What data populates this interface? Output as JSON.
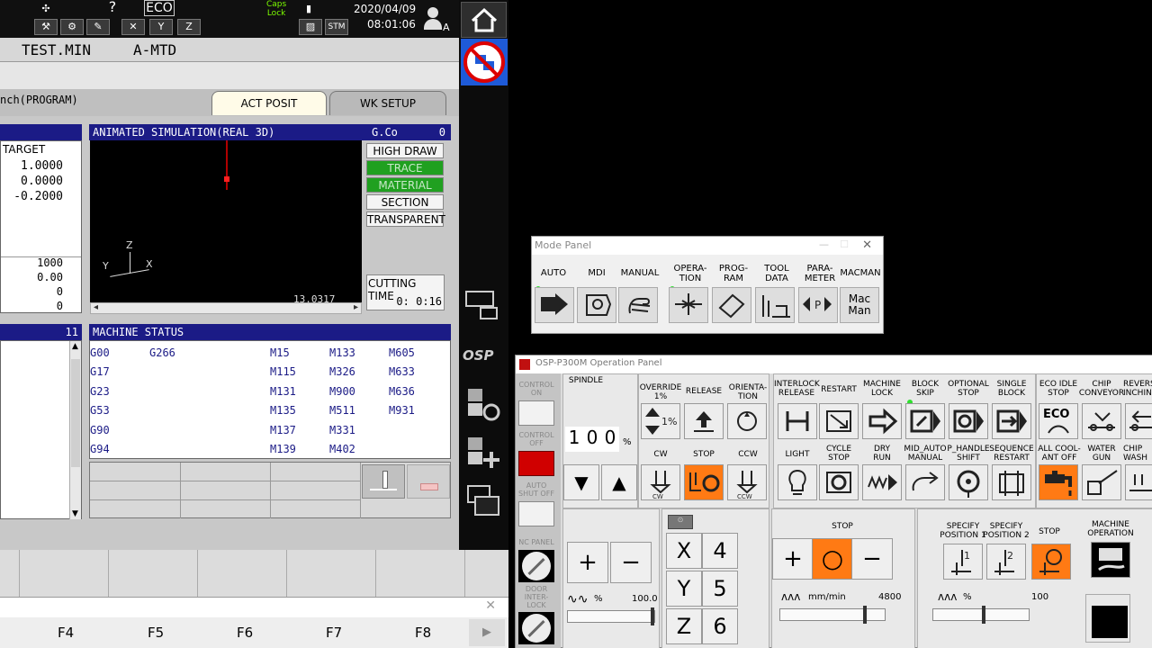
{
  "topbar": {
    "caps_lock": "Caps\nLock",
    "eco": "ECO",
    "stm": "STM",
    "date": "2020/04/09",
    "time": "08:01:06",
    "user_suffix": "A",
    "help": "?"
  },
  "filebar": {
    "program": "TEST.MIN",
    "subprogram": "A-MTD"
  },
  "tabs": {
    "launch": "nch(PROGRAM)",
    "act_posit": "ACT POSIT",
    "wk_setup": "WK SETUP"
  },
  "target": {
    "label": "TARGET",
    "values": [
      "1.0000",
      "0.0000",
      "-0.2000"
    ],
    "lower_values": [
      "1000",
      "0.00",
      "0",
      "0"
    ]
  },
  "simulation": {
    "title": "ANIMATED SIMULATION(REAL 3D)",
    "gcode_label": "G.Co",
    "gcode_value": "0",
    "buttons": [
      "HIGH DRAW",
      "TRACE",
      "MATERIAL",
      "SECTION",
      "TRANSPARENT"
    ],
    "axis_z": "Z",
    "axis_y": "Y",
    "axis_x": "X",
    "coord_readout": "13.0317",
    "cutting_time_label": "CUTTING TIME",
    "cutting_time_value": "0: 0:16"
  },
  "machine_status": {
    "title": "MACHINE STATUS",
    "count": "11",
    "g_codes_col1": [
      "G00",
      "G17",
      "G23",
      "G53",
      "G90",
      "G94"
    ],
    "g_codes_col2": [
      "G266"
    ],
    "m_codes_col1": [
      "M15",
      "M115",
      "M131",
      "M135",
      "M137",
      "M139"
    ],
    "m_codes_col2": [
      "M133",
      "M326",
      "M900",
      "M511",
      "M331",
      "M402"
    ],
    "m_codes_col3": [
      "M605",
      "M633",
      "M636",
      "M931"
    ]
  },
  "fkeys": [
    "F4",
    "F5",
    "F6",
    "F7",
    "F8"
  ],
  "sidebar": {
    "osp_logo": "OSP"
  },
  "mode_panel": {
    "title": "Mode Panel",
    "modes": [
      "AUTO",
      "MDI",
      "MANUAL",
      "OPERA-\nTION",
      "PROG-\nRAM",
      "TOOL\nDATA",
      "PARA-\nMETER",
      "MACMAN"
    ],
    "macman_btn": "Mac\nMan"
  },
  "op_panel": {
    "title": "OSP-P300M Operation Panel",
    "control_on": "CONTROL\nON",
    "control_off": "CONTROL\nOFF",
    "auto_shut_off": "AUTO\nSHUT OFF",
    "nc_panel": "NC PANEL",
    "door_interlock": "DOOR\nINTER-\nLOCK",
    "spindle": "SPINDLE",
    "spindle_value": [
      "1",
      "0",
      "0"
    ],
    "spindle_unit": "%",
    "override": "OVERRIDE\n1%",
    "release": "RELEASE",
    "orientation": "ORIENTA-\nTION",
    "cw": "CW",
    "stop": "STOP",
    "ccw": "CCW",
    "interlock_release": "INTERLOCK\nRELEASE",
    "restart": "RESTART",
    "machine_lock": "MACHINE\nLOCK",
    "block_skip": "BLOCK\nSKIP",
    "optional_stop": "OPTIONAL\nSTOP",
    "single_block": "SINGLE\nBLOCK",
    "light": "LIGHT",
    "cycle_stop": "CYCLE\nSTOP",
    "dry_run": "DRY\nRUN",
    "mid_auto_manual": "MID_AUTO\nMANUAL",
    "p_handle_shift": "P_HANDLE\nSHIFT",
    "sequence_restart": "SEQUENCE\nRESTART",
    "eco_idle_stop": "ECO IDLE\nSTOP",
    "chip_conveyor": "CHIP\nCONVEYOR",
    "reverse_inching": "REVERS\nINCHIN",
    "all_coolant_off": "ALL COOL-\nANT OFF",
    "water_gun": "WATER\nGUN",
    "chip_wash": "CHIP\nWASH",
    "eco_btn": "ECO",
    "spindle_override_value": "100.0",
    "feed_stop": "STOP",
    "feed_unit": "mm/min",
    "feed_value": "4800",
    "specify_position_1": "SPECIFY\nPOSITION 1",
    "specify_position_2": "SPECIFY\nPOSITION 2",
    "rapid_stop": "STOP",
    "machine_operation": "MACHINE\nOPERATION",
    "rapid_percent": "%",
    "rapid_value": "100",
    "axis_keys": [
      "X",
      "Y",
      "Z"
    ],
    "num_keys": [
      "4",
      "5",
      "6"
    ],
    "plus": "+",
    "minus": "−",
    "spindle_pct_label": "%",
    "pos_1": "1",
    "pos_2": "2"
  },
  "colors": {
    "panel_blue": "#1b1b86",
    "active_green": "#20a020",
    "orange": "#ff7a14",
    "control_off_red": "#d00000"
  }
}
